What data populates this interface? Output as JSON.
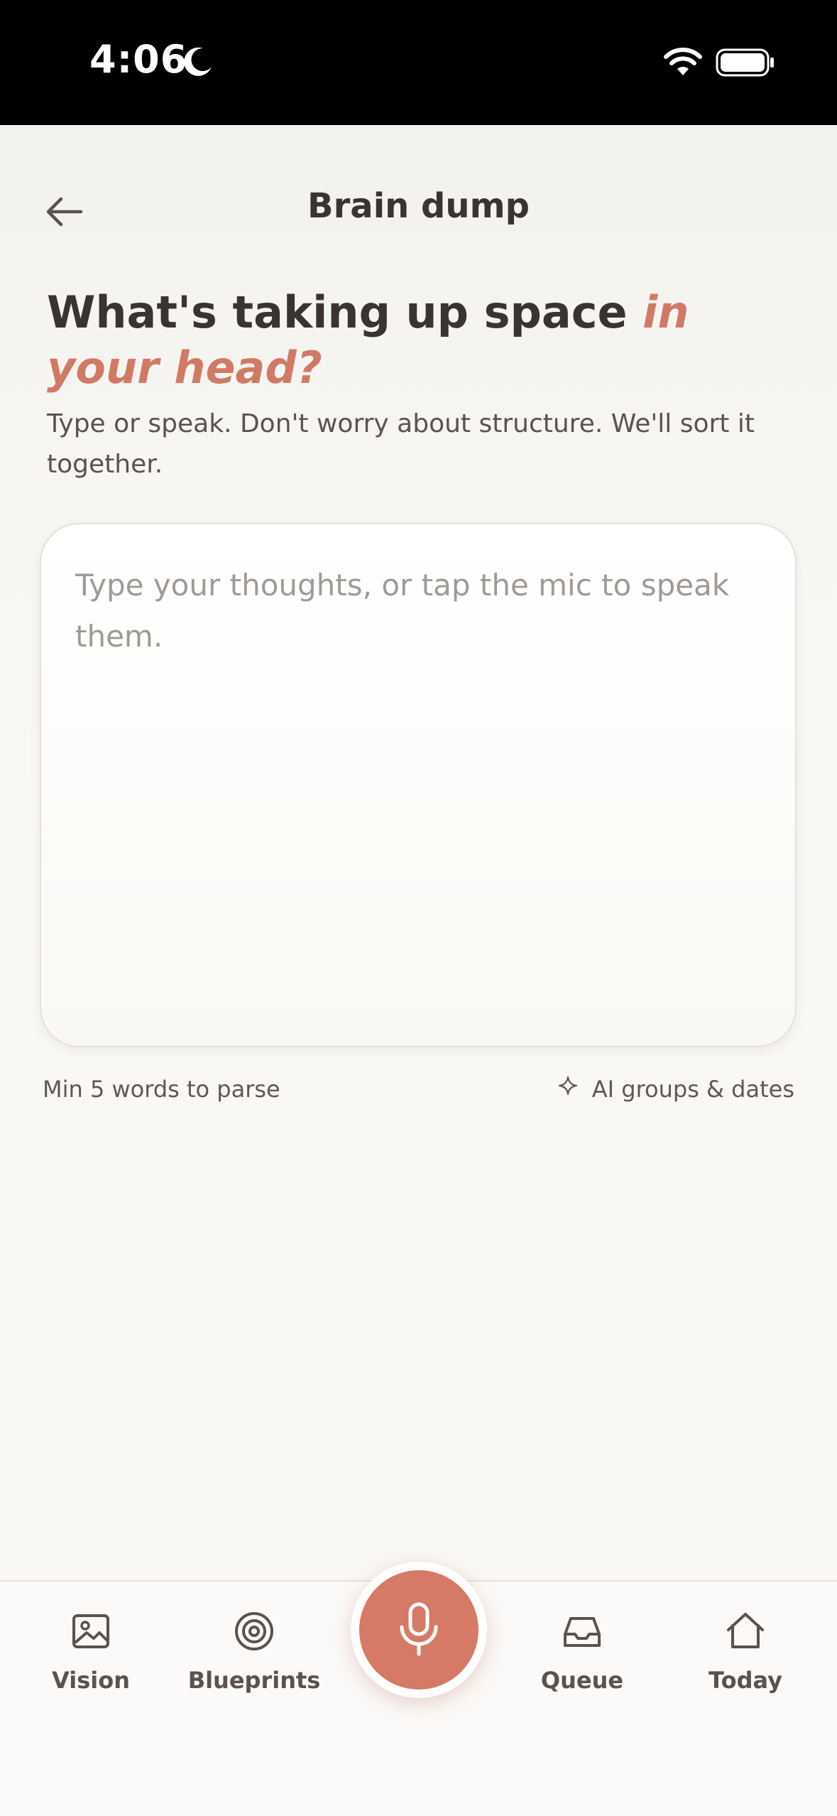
{
  "status_bar": {
    "time": "4:06"
  },
  "header": {
    "title": "Brain dump",
    "back_icon": "arrow-left-icon"
  },
  "headline": {
    "text_plain": "What's taking up space ",
    "text_accent": "in your head?"
  },
  "subtitle": "Type or speak. Don't worry about structure. We'll sort it together.",
  "input": {
    "value": "",
    "placeholder": "Type your thoughts, or tap the mic to speak them."
  },
  "hints": {
    "left": "Min 5 words to parse",
    "right": "AI groups & dates",
    "right_icon": "sparkle-icon"
  },
  "tabs": [
    {
      "label": "Vision",
      "icon": "image-icon"
    },
    {
      "label": "Blueprints",
      "icon": "target-icon"
    },
    {
      "label": "Queue",
      "icon": "inbox-icon"
    },
    {
      "label": "Today",
      "icon": "home-icon"
    }
  ],
  "mic_button": {
    "icon": "microphone-icon"
  },
  "colors": {
    "accent": "#d57a66",
    "accent_text": "#d07a66",
    "text_primary": "#3a3431",
    "text_secondary": "#5a524e",
    "placeholder": "#a09a95",
    "background": "#f9f8f5",
    "status_bar": "#000000"
  }
}
